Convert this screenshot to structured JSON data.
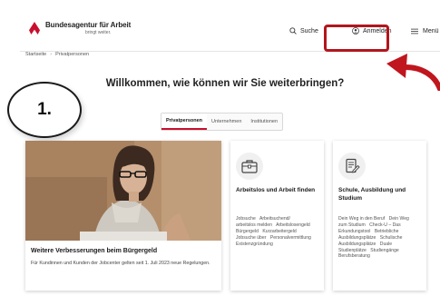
{
  "header": {
    "brand_title": "Bundesagentur für Arbeit",
    "brand_slogan": "bringt weiter.",
    "search_label": "Suche",
    "login_label": "Anmelden",
    "menu_label": "Menü"
  },
  "breadcrumb": {
    "items": [
      "Startseite",
      "Privatpersonen"
    ],
    "separator": "›"
  },
  "step_badge": "1.",
  "page_title": "Willkommen, wie können wir Sie weiterbringen?",
  "tabs": [
    "Privatpersonen",
    "Unternehmen",
    "Institutionen"
  ],
  "hero": {
    "title": "Weitere Verbesserungen beim Bürgergeld",
    "text": "Für Kundinnen und Kunden der Jobcenter gelten seit 1. Juli 2023 neue Regelungen."
  },
  "cards": [
    {
      "title": "Arbeitslos und Arbeit finden",
      "icon": "briefcase-icon",
      "links": [
        "Jobsuche",
        "Arbeitsuchend/",
        "arbeitslos melden",
        "Arbeitslosengeld",
        "Bürgergeld",
        "Kurzarbeitergeld",
        "Jobsuche über",
        "Personalvermittlung",
        "Existenzgründung"
      ]
    },
    {
      "title": "Schule, Ausbildung und Studium",
      "icon": "document-pen-icon",
      "links": [
        "Dein Weg in den Beruf",
        "Dein Weg",
        "zum Studium",
        "Check-U – Das",
        "Erkundungstool",
        "Betriebliche",
        "Ausbildungsplätze",
        "Schulische",
        "Ausbildungsplätze",
        "Duale",
        "Studienplätze",
        "Studiengänge",
        "Berufsberatung"
      ]
    }
  ],
  "colors": {
    "brand_red": "#c8102e",
    "annotation_red": "#b3151c"
  }
}
